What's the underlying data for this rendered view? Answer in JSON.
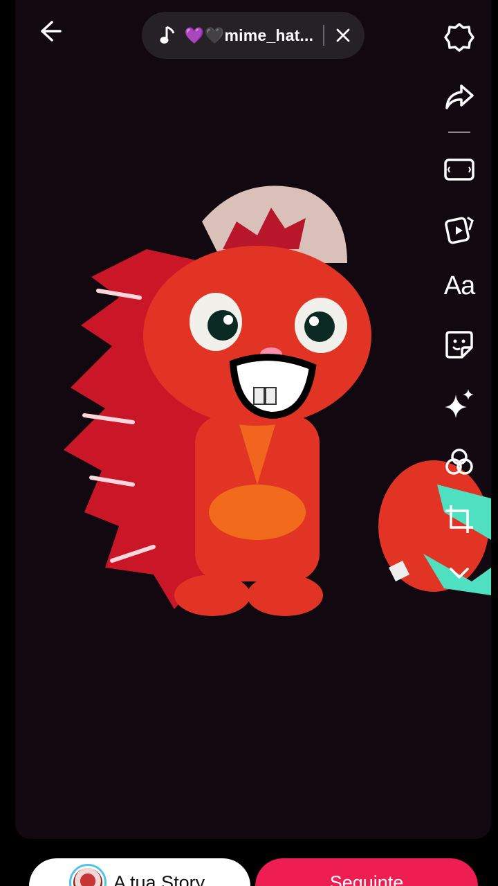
{
  "music": {
    "title": "💜🖤mime_hat..."
  },
  "toolbar": {
    "text_tool_label": "Aa"
  },
  "bottom": {
    "story_label": "A tua Story",
    "next_label": "Seguinte"
  },
  "colors": {
    "canvas_bg": "#12080f",
    "pill_bg": "#262126",
    "next_button": "#ee1d52",
    "story_ring": "#4fc3e8"
  },
  "icons": [
    "back-arrow-icon",
    "music-note-icon",
    "close-icon",
    "settings-icon",
    "share-icon",
    "aspect-ratio-icon",
    "template-icon",
    "sticker-icon",
    "sparkle-effects-icon",
    "filters-icon",
    "crop-icon",
    "chevron-down-icon"
  ]
}
